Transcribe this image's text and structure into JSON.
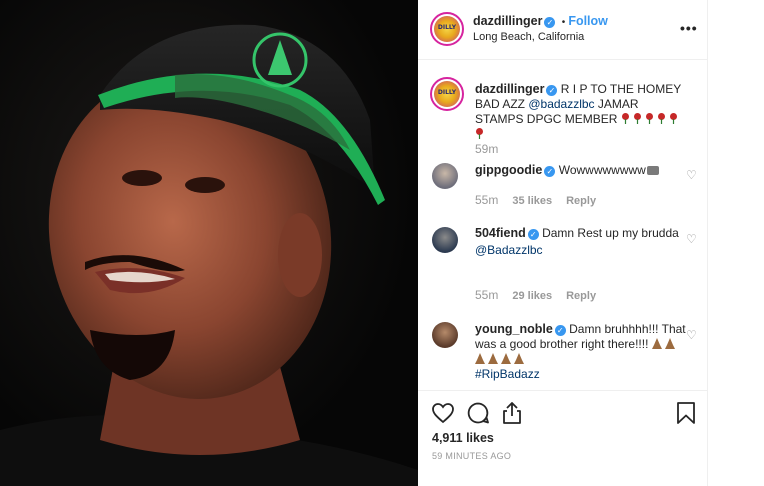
{
  "post_author": {
    "username": "dazdillinger",
    "follow_label": "Follow",
    "location": "Long Beach, California",
    "avatar_text": "DILLY"
  },
  "more_label": "•••",
  "caption": {
    "username": "dazdillinger",
    "text_part1": "R I P TO THE HOMEY BAD AZZ ",
    "mention": "@badazzlbc",
    "text_part2": " JAMAR STAMPS DPGC MEMBER",
    "emoji_count": 6,
    "time": "59m"
  },
  "comments": [
    {
      "username": "gippgoodie",
      "text": "Wowwwwwwww",
      "time": "55m",
      "likes": "35 likes",
      "reply": "Reply"
    },
    {
      "username": "504fiend",
      "text": "Damn Rest up my brudda",
      "mention": "@Badazzlbc",
      "time": "55m",
      "likes": "29 likes",
      "reply": "Reply"
    },
    {
      "username": "young_noble",
      "text": "Damn bruhhhh!!! That was a good brother right there!!!!",
      "emoji_count": 6,
      "hashtag": "#RipBadazz"
    }
  ],
  "likes_count": "4,911 likes",
  "posted_ago": "59 MINUTES AGO",
  "icons": [
    "heart-icon",
    "comment-icon",
    "share-icon",
    "bookmark-icon",
    "more-icon",
    "verified-icon"
  ]
}
